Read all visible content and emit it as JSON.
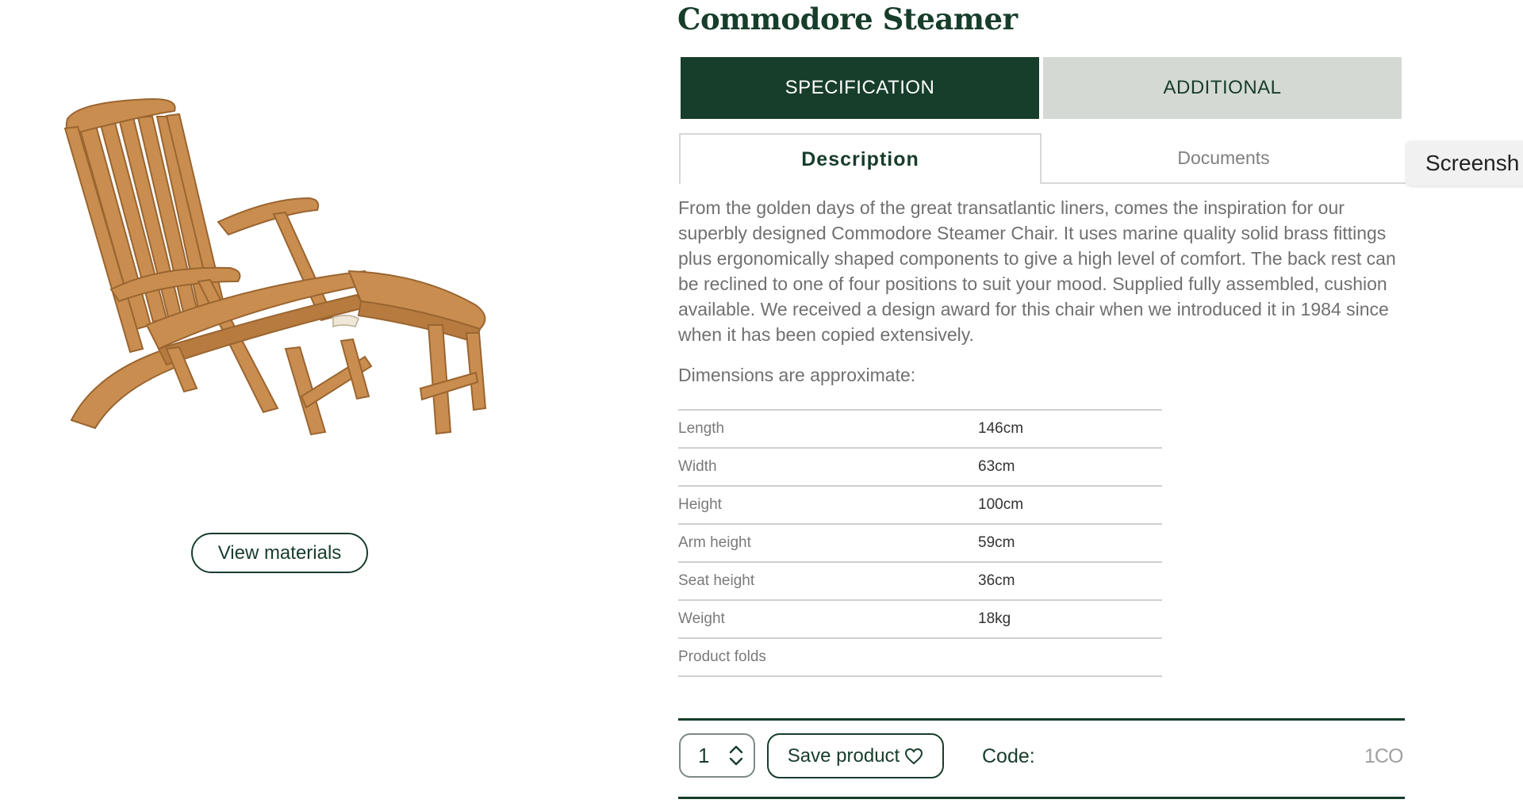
{
  "product": {
    "title": "Commodore Steamer",
    "view_materials_label": "View materials",
    "image_alt": "Teak steamer deck chair"
  },
  "tabs": {
    "primary": [
      {
        "label": "SPECIFICATION",
        "active": true
      },
      {
        "label": "ADDITIONAL",
        "active": false
      }
    ],
    "secondary": [
      {
        "label": "Description",
        "active": true
      },
      {
        "label": "Documents",
        "active": false
      }
    ]
  },
  "screenshot_tab": {
    "label": "Screensh"
  },
  "description": "From the golden days of the great transatlantic liners, comes the inspiration for our superbly designed Commodore Steamer Chair. It uses marine quality solid brass fittings plus ergonomically shaped components to give a high level of comfort. The back rest can be reclined to one of four positions to suit your mood. Supplied fully assembled, cushion available. We received a design award for this chair when we introduced it in 1984 since when it has been copied extensively.",
  "dimensions": {
    "heading": "Dimensions are approximate:",
    "rows": [
      {
        "label": "Length",
        "value": "146cm"
      },
      {
        "label": "Width",
        "value": "63cm"
      },
      {
        "label": "Height",
        "value": "100cm"
      },
      {
        "label": "Arm height",
        "value": "59cm"
      },
      {
        "label": "Seat height",
        "value": "36cm"
      },
      {
        "label": "Weight",
        "value": "18kg"
      },
      {
        "label": "Product folds",
        "value": ""
      }
    ]
  },
  "purchase": {
    "quantity": "1",
    "save_label": "Save product",
    "code_label": "Code:",
    "code_value": "1CO"
  },
  "colors": {
    "brand_green": "#173d2b",
    "inactive_tab": "#d4d9d4",
    "body_text": "#707070",
    "teak": "#c98d4f"
  },
  "icons": {
    "quantity": "chevron-up-down-icon",
    "save": "heart-icon"
  }
}
